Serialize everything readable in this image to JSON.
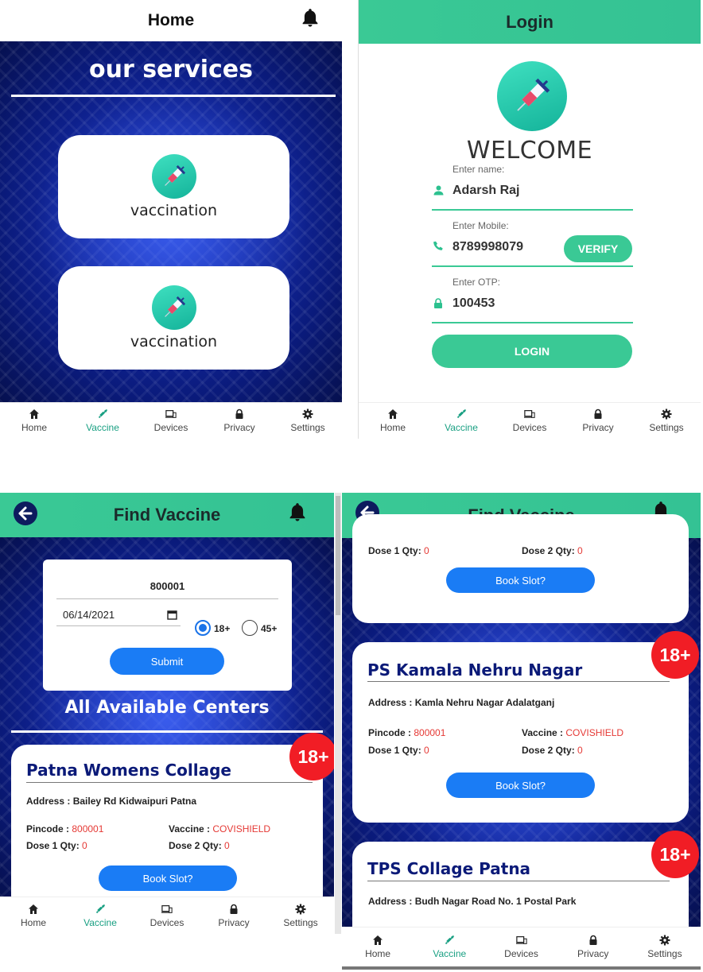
{
  "home": {
    "title": "Home",
    "section_title": "our services",
    "cards": [
      {
        "label": "vaccination",
        "icon": "syringe-icon"
      },
      {
        "label": "vaccination",
        "icon": "syringe-icon"
      }
    ]
  },
  "login": {
    "title": "Login",
    "welcome": "WELCOME",
    "name_label": "Enter name:",
    "name_value": "Adarsh Raj",
    "mobile_label": "Enter Mobile:",
    "mobile_value": "8789998079",
    "verify_label": "VERIFY",
    "otp_label": "Enter OTP:",
    "otp_value": "100453",
    "login_label": "LOGIN"
  },
  "nav": {
    "items": [
      {
        "label": "Home",
        "icon": "home-icon"
      },
      {
        "label": "Vaccine",
        "icon": "syringe-icon"
      },
      {
        "label": "Devices",
        "icon": "devices-icon"
      },
      {
        "label": "Privacy",
        "icon": "lock-icon"
      },
      {
        "label": "Settings",
        "icon": "gear-icon"
      }
    ],
    "active": "Vaccine"
  },
  "find": {
    "title": "Find Vaccine",
    "pincode": "800001",
    "date": "06/14/2021",
    "age_options": [
      "18+",
      "45+"
    ],
    "selected_age": "18+",
    "submit_label": "Submit",
    "centers_title": "All Available Centers",
    "labels": {
      "address": "Address : ",
      "pincode": "Pincode : ",
      "vaccine": "Vaccine : ",
      "dose1": "Dose 1 Qty: ",
      "dose2": "Dose 2 Qty: ",
      "book": "Book Slot?"
    },
    "centers": [
      {
        "name": "Patna Womens Collage",
        "address": "Bailey Rd Kidwaipuri Patna",
        "pincode": "800001",
        "vaccine": "COVISHIELD",
        "dose1": "0",
        "dose2": "0",
        "age": "18+"
      },
      {
        "name": "PS Kamala Nehru Nagar",
        "address": "Kamla Nehru Nagar Adalatganj",
        "pincode": "800001",
        "vaccine": "COVISHIELD",
        "dose1": "0",
        "dose2": "0",
        "age": "18+"
      },
      {
        "name": "TPS Collage Patna",
        "address": "Budh Nagar Road No. 1 Postal Park",
        "age": "18+"
      }
    ],
    "partial_card": {
      "dose1": "0",
      "dose2": "0"
    }
  },
  "colors": {
    "accent_green": "#3ac995",
    "button_blue": "#1a7cf5",
    "badge_red": "#f11d25",
    "center_name": "#0b1a78",
    "nav_active": "#1aa083"
  }
}
